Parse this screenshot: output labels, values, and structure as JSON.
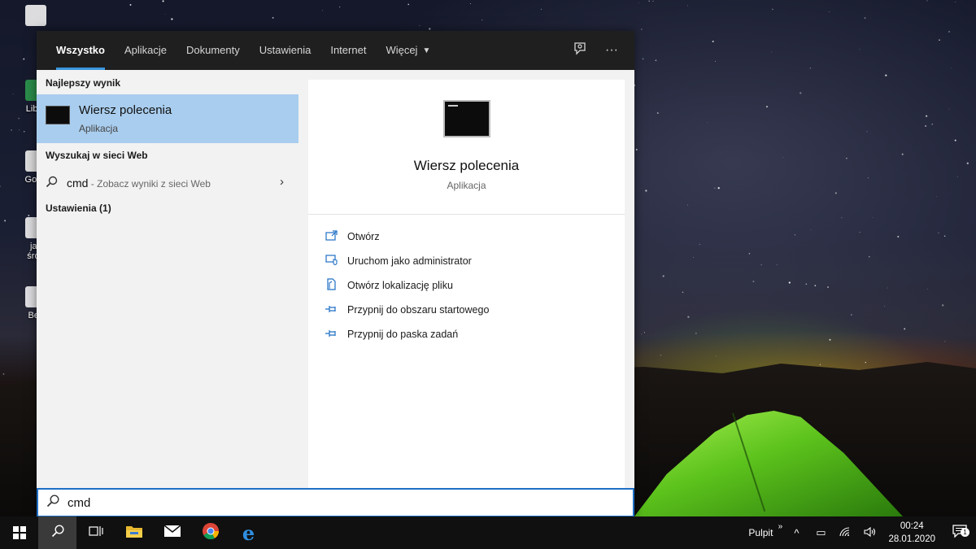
{
  "desktop": {
    "icons": [
      {
        "label": "",
        "icon": "recycle-bin-icon"
      },
      {
        "label": "Libre",
        "icon": "libreoffice-icon"
      },
      {
        "label": "Goog",
        "icon": "google-chrome-icon"
      },
      {
        "label": "jak",
        "label2": "środ",
        "icon": "document-icon"
      },
      {
        "label": "Bez",
        "icon": "document-icon"
      }
    ]
  },
  "search_panel": {
    "tabs": [
      {
        "label": "Wszystko",
        "active": true
      },
      {
        "label": "Aplikacje"
      },
      {
        "label": "Dokumenty"
      },
      {
        "label": "Ustawienia"
      },
      {
        "label": "Internet"
      },
      {
        "label": "Więcej",
        "has_caret": true
      }
    ],
    "tools": {
      "feedback_icon": "feedback-icon",
      "more_icon": "more-options-icon"
    },
    "left": {
      "best_header": "Najlepszy wynik",
      "best_result": {
        "title": "Wiersz polecenia",
        "subtitle": "Aplikacja",
        "icon": "command-prompt-icon"
      },
      "web_header": "Wyszukaj w sieci Web",
      "web_result": {
        "query": "cmd",
        "hint": " - Zobacz wyniki z sieci Web"
      },
      "settings_header": "Ustawienia (1)"
    },
    "preview": {
      "title": "Wiersz polecenia",
      "subtitle": "Aplikacja",
      "actions": [
        {
          "label": "Otwórz",
          "icon": "open-icon"
        },
        {
          "label": "Uruchom jako administrator",
          "icon": "run-as-admin-icon"
        },
        {
          "label": "Otwórz lokalizację pliku",
          "icon": "file-location-icon"
        },
        {
          "label": "Przypnij do obszaru startowego",
          "icon": "pin-to-start-icon"
        },
        {
          "label": "Przypnij do paska zadań",
          "icon": "pin-to-taskbar-icon"
        }
      ]
    },
    "search_box": {
      "value": "cmd"
    }
  },
  "taskbar": {
    "pinned": [
      "start-icon",
      "search-icon",
      "task-view-icon",
      "file-explorer-icon",
      "mail-icon",
      "chrome-icon",
      "edge-icon"
    ],
    "tray": {
      "desktop_label": "Pulpit",
      "time": "00:24",
      "date": "28.01.2020",
      "notification_count": "1"
    }
  },
  "colors": {
    "accent": "#3a96dd",
    "selection": "#a9cdee",
    "panel_dark": "#1f1f1f",
    "link_blue": "#1f6fc5"
  }
}
